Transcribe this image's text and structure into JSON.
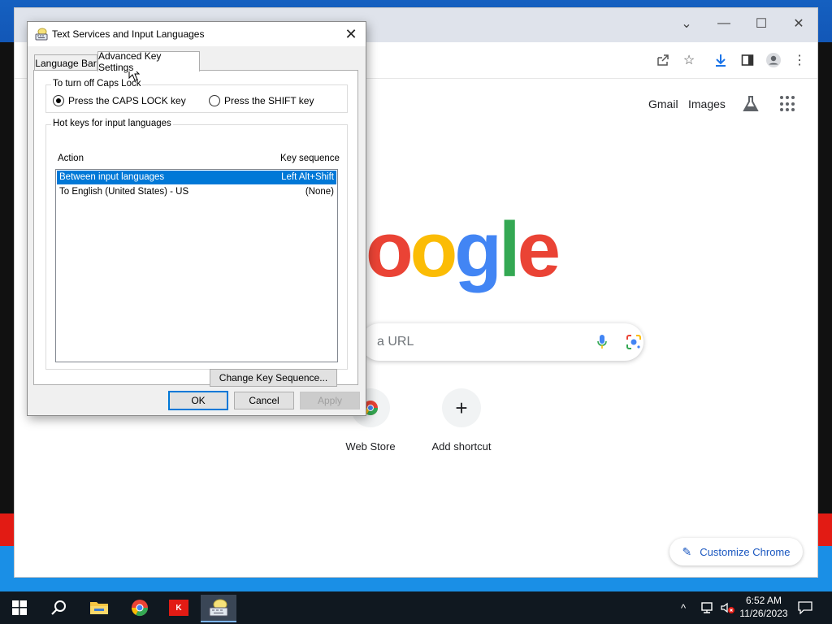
{
  "chrome": {
    "top_links": {
      "gmail": "Gmail",
      "images": "Images"
    },
    "search_placeholder": "a URL",
    "shortcuts": [
      {
        "label": "Web Store",
        "icon": "chrome-web-store-icon"
      },
      {
        "label": "Add shortcut",
        "icon": "plus-icon",
        "glyph": "+"
      }
    ],
    "customize_label": "Customize Chrome",
    "logo_text": "oogle",
    "logo_colors": [
      "#ea4335",
      "#fbbc05",
      "#4285f4",
      "#34a853",
      "#ea4335"
    ]
  },
  "dialog": {
    "title": "Text Services and Input Languages",
    "tabs": [
      {
        "label": "Language Bar",
        "active": false
      },
      {
        "label": "Advanced Key Settings",
        "active": true
      }
    ],
    "caps_lock": {
      "group_label": "To turn off Caps Lock",
      "options": [
        {
          "label": "Press the CAPS LOCK key",
          "selected": true
        },
        {
          "label": "Press the SHIFT key",
          "selected": false
        }
      ]
    },
    "hotkeys": {
      "group_label": "Hot keys for input languages",
      "columns": {
        "action": "Action",
        "sequence": "Key sequence"
      },
      "rows": [
        {
          "action": "Between input languages",
          "sequence": "Left Alt+Shift",
          "selected": true
        },
        {
          "action": "To English (United States) - US",
          "sequence": "(None)",
          "selected": false
        }
      ],
      "change_button": "Change Key Sequence..."
    },
    "buttons": {
      "ok": "OK",
      "cancel": "Cancel",
      "apply": "Apply"
    }
  },
  "taskbar": {
    "apps": [
      "start-icon",
      "search-icon",
      "file-explorer-icon",
      "chrome-icon",
      "app-icon",
      "keyboard-language-icon"
    ],
    "app_badge_text": "K",
    "clock": {
      "time": "6:52 AM",
      "date": "11/26/2023"
    }
  },
  "colors": {
    "accent": "#0078d7",
    "chrome_link": "#1a57c0"
  }
}
